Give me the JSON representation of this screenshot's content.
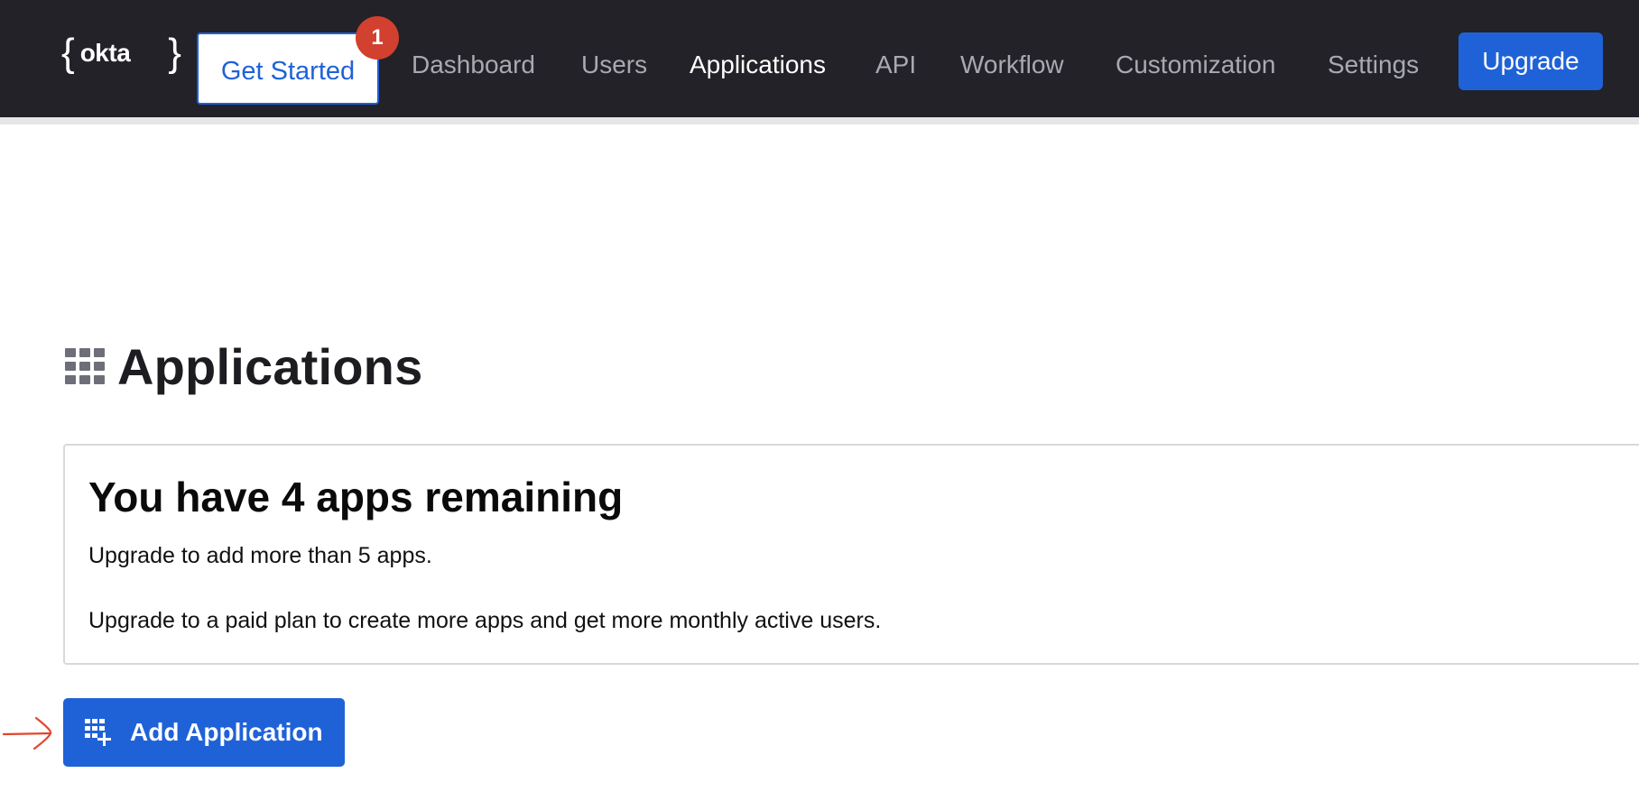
{
  "header": {
    "logo_text": "okta",
    "logo_brace_open": "{",
    "logo_brace_close": "}",
    "get_started_label": "Get Started",
    "get_started_badge": "1",
    "nav": [
      {
        "label": "Dashboard",
        "active": false
      },
      {
        "label": "Users",
        "active": false
      },
      {
        "label": "Applications",
        "active": true
      },
      {
        "label": "API",
        "active": false
      },
      {
        "label": "Workflow",
        "active": false
      },
      {
        "label": "Customization",
        "active": false
      },
      {
        "label": "Settings",
        "active": false
      }
    ],
    "upgrade_label": "Upgrade"
  },
  "page": {
    "title": "Applications",
    "title_icon": "grid-icon"
  },
  "notice": {
    "title": "You have 4 apps remaining",
    "line1": "Upgrade to add more than 5 apps.",
    "line2": "Upgrade to a paid plan to create more apps and get more monthly active users."
  },
  "actions": {
    "add_application_label": "Add Application",
    "add_application_icon": "grid-plus-icon"
  },
  "annotation": {
    "icon": "arrow-right-icon"
  },
  "colors": {
    "topbar": "#222228",
    "accent_blue": "#1f62d8",
    "badge_red": "#d2402f",
    "nav_inactive": "#a9a9b1",
    "nav_active": "#ffffff",
    "annotation_red": "#e2452a"
  }
}
